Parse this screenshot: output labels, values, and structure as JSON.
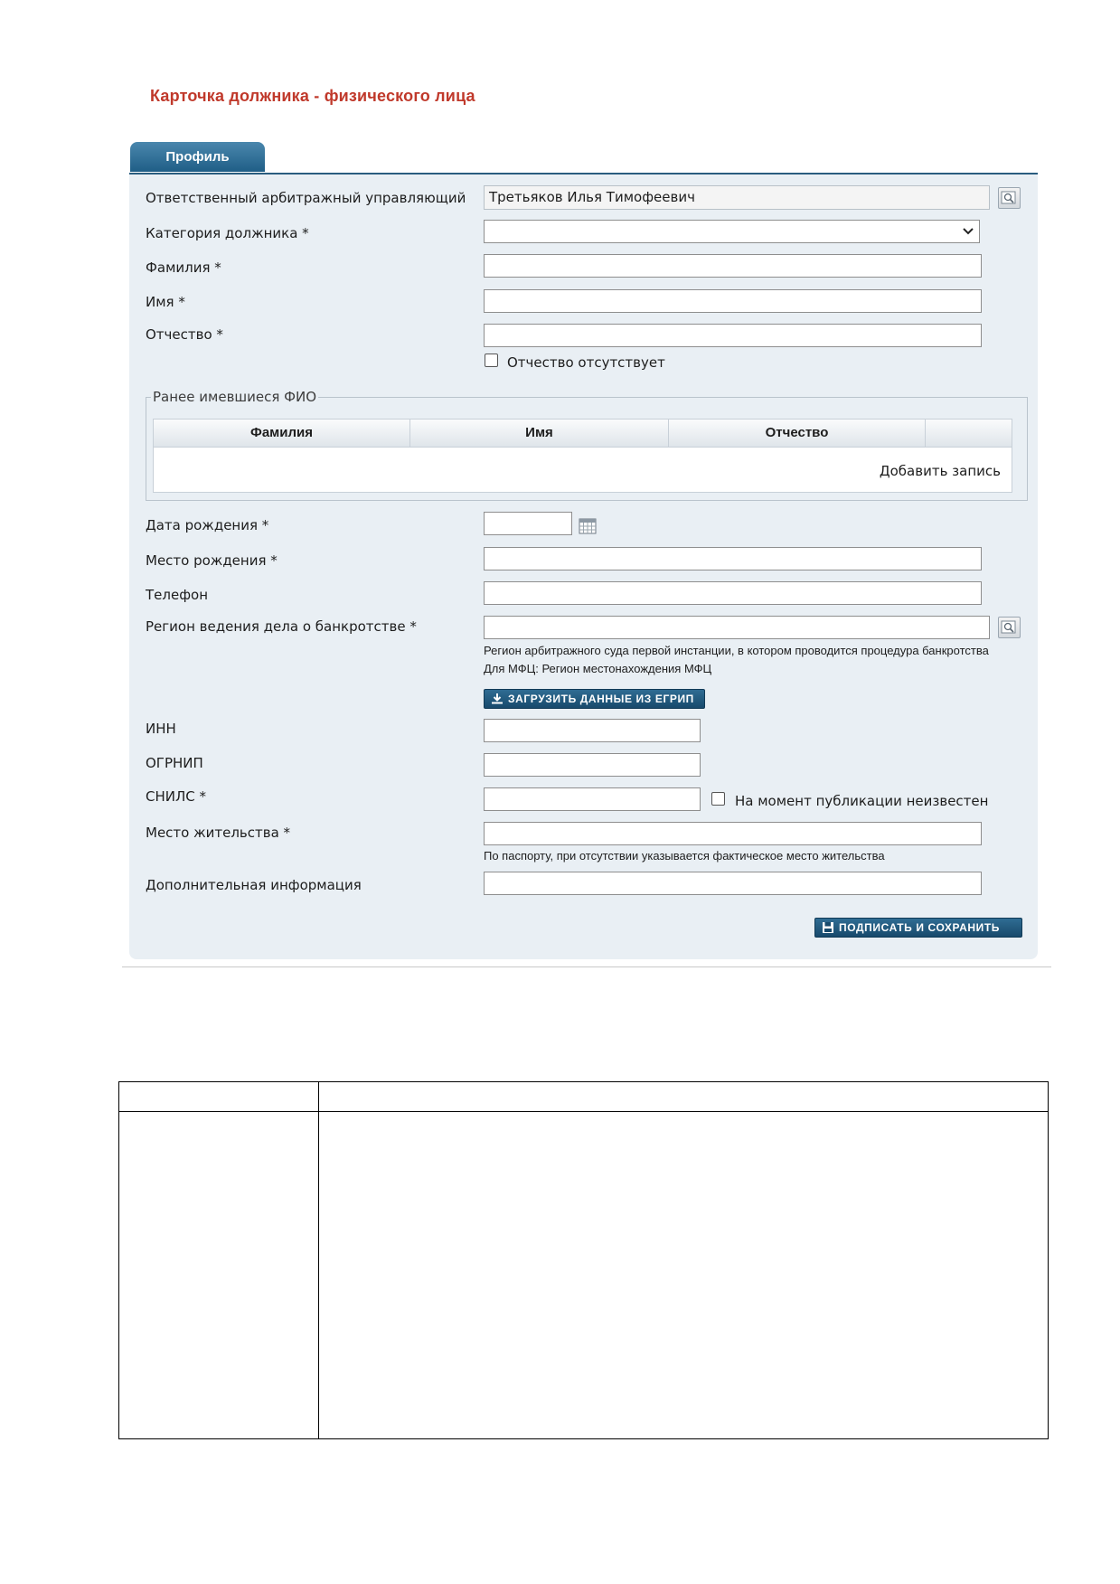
{
  "page": {
    "title": "Карточка должника - физического лица"
  },
  "tabs": [
    {
      "label": "Профиль"
    }
  ],
  "form": {
    "manager": {
      "label": "Ответственный арбитражный управляющий",
      "value": "Третьяков Илья Тимофеевич"
    },
    "category": {
      "label": "Категория должника *",
      "value": ""
    },
    "last_name": {
      "label": "Фамилия *",
      "value": ""
    },
    "first_name": {
      "label": "Имя *",
      "value": ""
    },
    "patronymic": {
      "label": "Отчество *",
      "value": ""
    },
    "no_patronymic": {
      "label": "Отчество отсутствует",
      "checked": false
    },
    "previous_names": {
      "legend": "Ранее имевшиеся ФИО",
      "columns": [
        "Фамилия",
        "Имя",
        "Отчество"
      ],
      "add_label": "Добавить запись"
    },
    "birth_date": {
      "label": "Дата рождения *",
      "value": ""
    },
    "birth_place": {
      "label": "Место рождения *",
      "value": ""
    },
    "phone": {
      "label": "Телефон",
      "value": ""
    },
    "region": {
      "label": "Регион ведения дела о банкротстве *",
      "value": "",
      "hint1": "Регион арбитражного суда первой инстанции, в котором проводится процедура банкротства",
      "hint2": "Для МФЦ: Регион местонахождения МФЦ"
    },
    "load_egrip_button": "ЗАГРУЗИТЬ ДАННЫЕ ИЗ ЕГРИП",
    "inn": {
      "label": "ИНН",
      "value": ""
    },
    "ogrnip": {
      "label": "ОГРНИП",
      "value": ""
    },
    "snils": {
      "label": "СНИЛС *",
      "value": ""
    },
    "snils_unknown": {
      "label": "На момент публикации неизвестен",
      "checked": false
    },
    "residence": {
      "label": "Место жительства *",
      "value": "",
      "hint": "По паспорту, при отсутствии указывается фактическое место жительства"
    },
    "extra_info": {
      "label": "Дополнительная информация",
      "value": ""
    },
    "sign_save_button": "ПОДПИСАТЬ И СОХРАНИТЬ"
  },
  "colors": {
    "title": "#c0392b",
    "tab": "#1f5e86",
    "panel": "#e9eff4",
    "button": "#184a6c"
  },
  "icons": {
    "lookup": "magnifier-lookup-icon",
    "calendar": "calendar-icon",
    "download": "download-icon",
    "save": "floppy-disk-icon",
    "select": "chevron-down-icon"
  }
}
